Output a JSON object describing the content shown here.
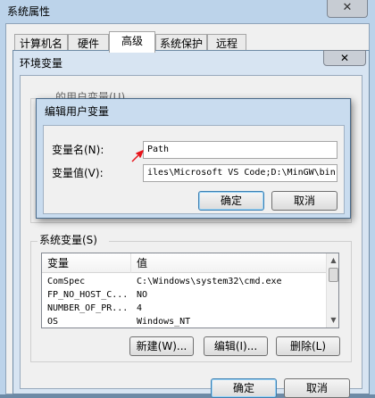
{
  "system_properties": {
    "title": "系统属性",
    "close_glyph": "✕",
    "tabs": [
      "计算机名",
      "硬件",
      "高级",
      "系统保护",
      "远程"
    ],
    "active_tab": "高级",
    "buttons": {
      "ok": "确定",
      "cancel": "取消"
    }
  },
  "env_vars": {
    "title": "环境变量",
    "close_glyph": "✕",
    "user_group_label": "的用户变量(U)",
    "system_group_label": "系统变量(S)",
    "columns": [
      "变量",
      "值"
    ],
    "rows": [
      {
        "name": "ComSpec",
        "value": "C:\\Windows\\system32\\cmd.exe"
      },
      {
        "name": "FP_NO_HOST_C...",
        "value": "NO"
      },
      {
        "name": "NUMBER_OF_PR...",
        "value": "4"
      },
      {
        "name": "OS",
        "value": "Windows_NT"
      }
    ],
    "buttons": {
      "new": "新建(W)...",
      "edit": "编辑(I)...",
      "delete": "删除(L)"
    }
  },
  "edit_dialog": {
    "title": "编辑用户变量",
    "name_label": "变量名(N):",
    "name_value": "Path",
    "value_label": "变量值(V):",
    "value_value": "iles\\Microsoft VS Code;D:\\MinGW\\bin",
    "buttons": {
      "ok": "确定",
      "cancel": "取消"
    }
  },
  "colors": {
    "annotation_arrow": "#e8141b",
    "window_frame": "#bcd3ea"
  },
  "icons": {
    "arrow": "red-pointer-arrow-icon",
    "scroll_up": "scroll-up-arrow-icon",
    "scroll_down": "scroll-down-arrow-icon"
  }
}
